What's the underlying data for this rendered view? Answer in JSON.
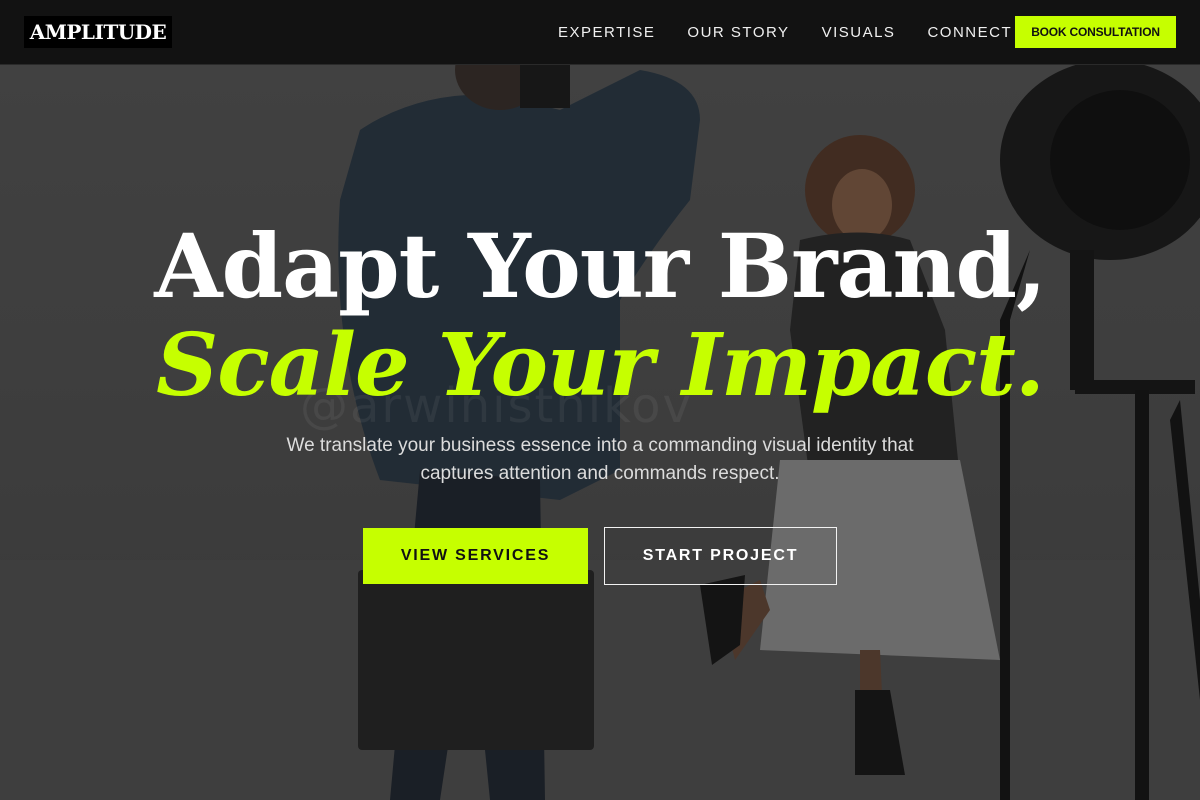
{
  "nav": {
    "logo": "AMPLITUDE",
    "links": [
      "EXPERTISE",
      "OUR STORY",
      "VISUALS",
      "CONNECT"
    ],
    "cta": "BOOK CONSULTATION"
  },
  "hero": {
    "headline_line1": "Adapt Your Brand,",
    "headline_line2": "Scale Your Impact.",
    "subtext": "We translate your business essence into a commanding visual identity that captures attention and commands respect.",
    "primary_button": "VIEW SERVICES",
    "secondary_button": "START PROJECT",
    "watermark": "@arwinistnikov"
  },
  "colors": {
    "accent": "#c6ff00",
    "nav_bg": "#121212",
    "text": "#ffffff"
  }
}
